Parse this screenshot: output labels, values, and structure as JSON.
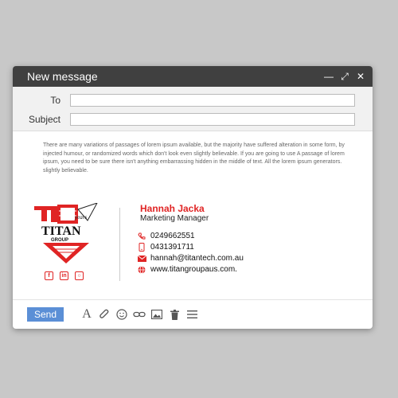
{
  "window": {
    "title": "New message"
  },
  "fields": {
    "to_label": "To",
    "subject_label": "Subject"
  },
  "body_text": "There are many variations of passages of lorem ipsum available, but the majority have suffered alteration in some form, by injected humour, or randomized words which don't look even slightly believable. If you are going to use A passage of lorem ipsum, you need to be sure there isn't anything embarrassing hidden in the middle of text. All the lorem ipsum generators. slightly believable.",
  "signature": {
    "logo_text": "TITAN",
    "logo_sub": "GROUP",
    "logo_years": "years",
    "name": "Hannah Jacka",
    "role": "Marketing Manager",
    "phone": "0249662551",
    "mobile": "0431391711",
    "email": "hannah@titantech.com.au",
    "website": "www.titangroupaus.com.",
    "accent_color": "#e02424",
    "socials": [
      "facebook-icon",
      "linkedin-icon",
      "instagram-icon"
    ]
  },
  "footer": {
    "send_label": "Send"
  }
}
